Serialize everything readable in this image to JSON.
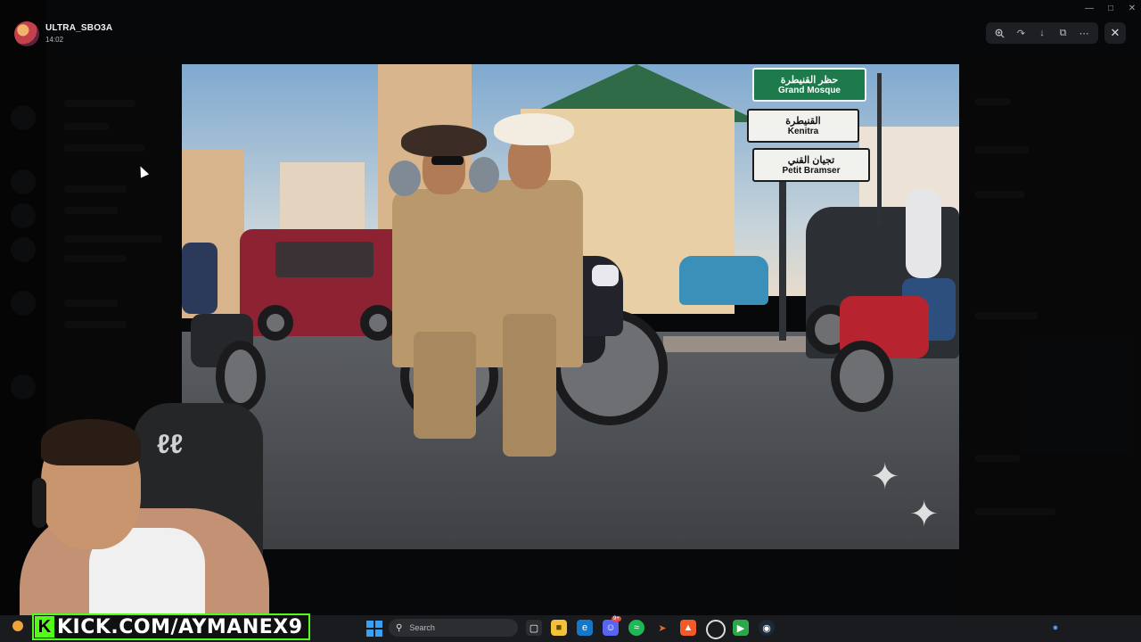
{
  "uploader": {
    "name": "ULTRA_SBO3A",
    "time": "14:02"
  },
  "toolbar": {
    "zoom_icon": "zoom-in-icon",
    "forward_icon": "forward-icon",
    "download_icon": "download-icon",
    "open_icon": "open-external-icon",
    "more_icon": "more-icon",
    "close_icon": "close-icon"
  },
  "image_signs": [
    {
      "arabic": "حظر القنيطرة",
      "english": "Grand Mosque"
    },
    {
      "arabic": "القنيطرة",
      "english": "Kenitra"
    },
    {
      "arabic": "تجيان القني",
      "english": "Petit Bramser"
    }
  ],
  "stream_overlay": {
    "kick_letter": "K",
    "kick_url": "KICK.COM/AYMANEX9"
  },
  "taskbar": {
    "search_placeholder": "Search",
    "notification_badge": "9+"
  },
  "colors": {
    "kick_green": "#53fc18",
    "discord_dark": "#111214",
    "sign_green": "#1c7a4b"
  }
}
